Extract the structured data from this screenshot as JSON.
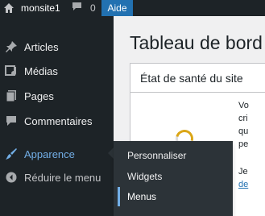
{
  "adminbar": {
    "site_name": "monsite1",
    "comments_count": "0",
    "help_label": "Aide"
  },
  "sidebar": {
    "items": [
      {
        "label": "Articles",
        "icon": "pin-icon"
      },
      {
        "label": "Médias",
        "icon": "media-icon"
      },
      {
        "label": "Pages",
        "icon": "pages-icon"
      },
      {
        "label": "Commentaires",
        "icon": "comment-icon"
      },
      {
        "label": "Apparence",
        "icon": "paintbrush-icon"
      },
      {
        "label": "Réduire le menu",
        "icon": "collapse-icon"
      }
    ],
    "current_color": "#72aee6"
  },
  "submenu": {
    "items": [
      {
        "label": "Personnaliser"
      },
      {
        "label": "Widgets"
      },
      {
        "label": "Menus"
      }
    ]
  },
  "main": {
    "title": "Tableau de bord",
    "site_health": {
      "title": "État de santé du site",
      "fragments": [
        "Vo",
        "cri",
        "qu",
        "pe",
        "Je",
        "de"
      ]
    }
  }
}
